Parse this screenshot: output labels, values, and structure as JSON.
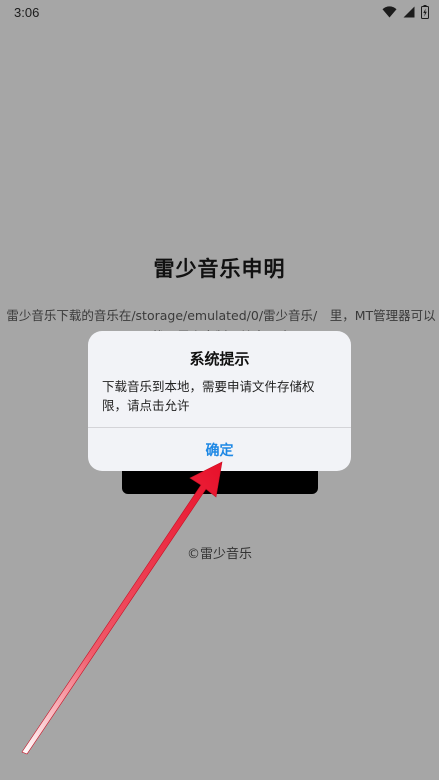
{
  "status_bar": {
    "time": "3:06",
    "icons": [
      "wifi-icon",
      "signal-icon",
      "battery-icon"
    ]
  },
  "page": {
    "title": "雷少音乐申明",
    "description": "雷少音乐下载的音乐在/storage/emulated/0/雷少音乐/　里，MT管理器可以找，雷少自制，禁止二改",
    "footer": "©雷少音乐"
  },
  "dialog": {
    "title": "系统提示",
    "message": "下载音乐到本地，需要申请文件存储权限，请点击允许",
    "confirm_label": "确定"
  },
  "colors": {
    "overlay_background": "#a6a6a6",
    "dialog_background": "#f2f3f7",
    "confirm_text": "#1e88e5",
    "arrow": "#e8102a"
  }
}
